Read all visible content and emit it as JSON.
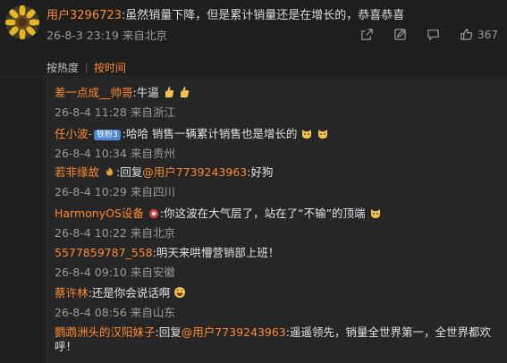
{
  "post": {
    "username": "用户3296723",
    "text": ":虽然销量下降，但是累计销量还是在增长的，恭喜恭喜",
    "time": "26-8-3 23:19",
    "location": "来自北京",
    "likes": "367"
  },
  "sort": {
    "hot": "按热度",
    "time": "按时间"
  },
  "replies": [
    {
      "name": "差一点成__帅哥",
      "text": ":牛逼",
      "time": "26-8-4 11:28",
      "location": "来自浙江"
    },
    {
      "name": "任小波-",
      "badge": "铁粉3",
      "text": ":哈哈  销售一辆累计销售也是增长的",
      "time": "26-8-4 10:34",
      "location": "来自贵州"
    },
    {
      "name": "若非缘故",
      "prefix": ":回复",
      "mention": "@用户7739243963",
      "text": ":好狗",
      "time": "26-8-4 10:29",
      "location": "来自四川"
    },
    {
      "name": "HarmonyOS设备",
      "text": ":你这波在大气层了，站在了“不输”的顶端",
      "time": "26-8-4 10:22",
      "location": "来自北京"
    },
    {
      "name": "5577859787_558",
      "text": ":明天来哄懵营销部上班！",
      "time": "26-8-4 09:10",
      "location": "来自安徽"
    },
    {
      "name": "蔡许林",
      "text": ":还是你会说话啊",
      "time": "26-8-4 08:56",
      "location": "来自山东"
    },
    {
      "name": "鹦鹉洲头的汉阳妹子",
      "prefix": ":回复",
      "mention": "@用户7739243963",
      "text": ":遥遥领先，销量全世界第一，全世界都欢呼！"
    }
  ],
  "icons": {
    "share": "share-icon",
    "edit": "edit-icon",
    "comment": "comment-icon",
    "like": "like-icon"
  },
  "colors": {
    "background": "#1e1e1e",
    "reply_panel": "#262626",
    "accent": "#ff8a2b",
    "text": "#e3e3e3",
    "meta": "#9a9a9a",
    "badge": "#4d87d6"
  }
}
